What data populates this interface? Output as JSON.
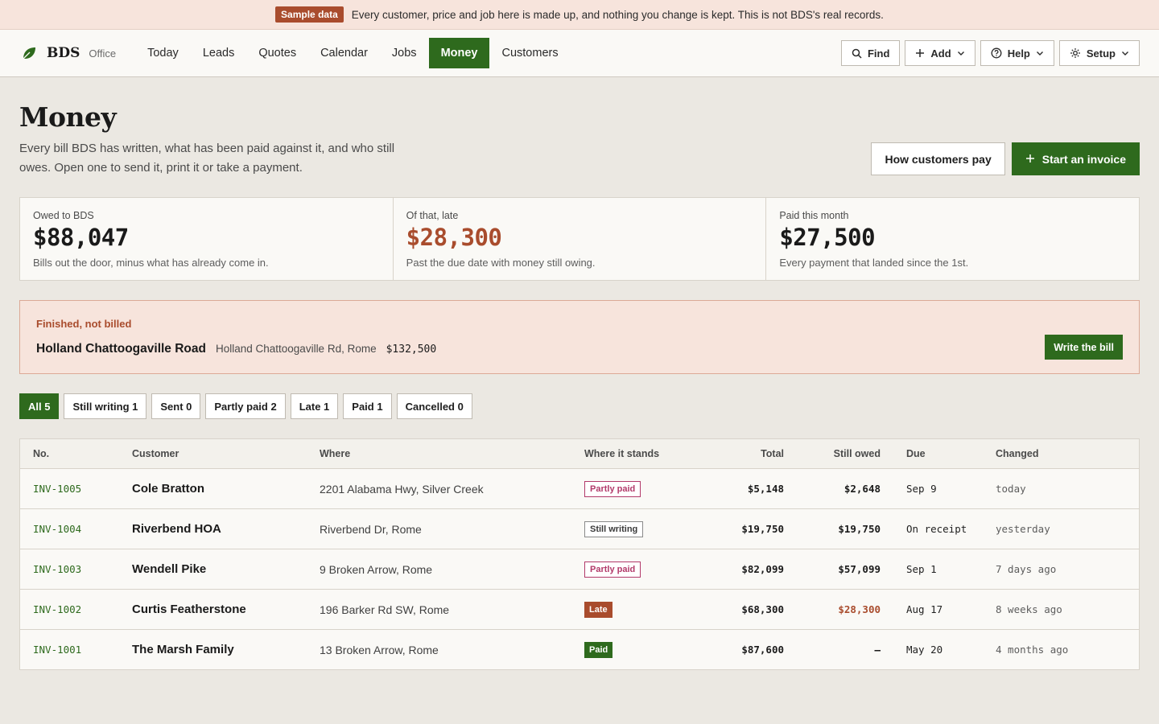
{
  "banner": {
    "tag": "Sample data",
    "message": "Every customer, price and job here is made up, and nothing you change is kept. This is not BDS's real records."
  },
  "brand": {
    "name": "BDS",
    "sub": "Office",
    "icon": "leaf-icon",
    "color": "#2e6a1d"
  },
  "nav": [
    "Today",
    "Leads",
    "Quotes",
    "Calendar",
    "Jobs",
    "Money",
    "Customers"
  ],
  "nav_active": "Money",
  "tools": {
    "find": "Find",
    "add": "Add",
    "help": "Help",
    "setup": "Setup"
  },
  "page": {
    "title": "Money",
    "intro": "Every bill BDS has written, what has been paid against it, and who still owes. Open one to send it, print it or take a payment.",
    "how_pay": "How customers pay",
    "start_invoice": "Start an invoice"
  },
  "stats": [
    {
      "label": "Owed to BDS",
      "value": "$88,047",
      "note": "Bills out the door, minus what has already come in."
    },
    {
      "label": "Of that, late",
      "value": "$28,300",
      "note": "Past the due date with money still owing."
    },
    {
      "label": "Paid this month",
      "value": "$27,500",
      "note": "Every payment that landed since the 1st."
    }
  ],
  "unbilled": {
    "kicker": "Finished, not billed",
    "job": "Holland Chattoogaville Road",
    "address": "Holland Chattoogaville Rd, Rome",
    "amount": "$132,500",
    "action": "Write the bill"
  },
  "filters": [
    "All 5",
    "Still writing 1",
    "Sent 0",
    "Partly paid 2",
    "Late 1",
    "Paid 1",
    "Cancelled 0"
  ],
  "filter_active": "All 5",
  "table": {
    "headers": {
      "no": "No.",
      "customer": "Customer",
      "where": "Where",
      "stands": "Where it stands",
      "total": "Total",
      "owed": "Still owed",
      "due": "Due",
      "changed": "Changed"
    },
    "rows": [
      {
        "no": "INV-1005",
        "customer": "Cole Bratton",
        "where": "2201 Alabama Hwy, Silver Creek",
        "status": "Partly paid",
        "total": "$5,148",
        "owed": "$2,648",
        "due": "Sep 9",
        "changed": "today"
      },
      {
        "no": "INV-1004",
        "customer": "Riverbend HOA",
        "where": "Riverbend Dr, Rome",
        "status": "Still writing",
        "total": "$19,750",
        "owed": "$19,750",
        "due": "On receipt",
        "changed": "yesterday"
      },
      {
        "no": "INV-1003",
        "customer": "Wendell Pike",
        "where": "9 Broken Arrow, Rome",
        "status": "Partly paid",
        "total": "$82,099",
        "owed": "$57,099",
        "due": "Sep 1",
        "changed": "7 days ago"
      },
      {
        "no": "INV-1002",
        "customer": "Curtis Featherstone",
        "where": "196 Barker Rd SW, Rome",
        "status": "Late",
        "total": "$68,300",
        "owed": "$28,300",
        "due": "Aug 17",
        "changed": "8 weeks ago"
      },
      {
        "no": "INV-1001",
        "customer": "The Marsh Family",
        "where": "13 Broken Arrow, Rome",
        "status": "Paid",
        "total": "$87,600",
        "owed": "–",
        "due": "May 20",
        "changed": "4 months ago"
      }
    ]
  },
  "colors": {
    "accent": "#2e6a1d",
    "late": "#a94c2d",
    "partly": "#b23a6a",
    "background": "#ebe8e2"
  }
}
